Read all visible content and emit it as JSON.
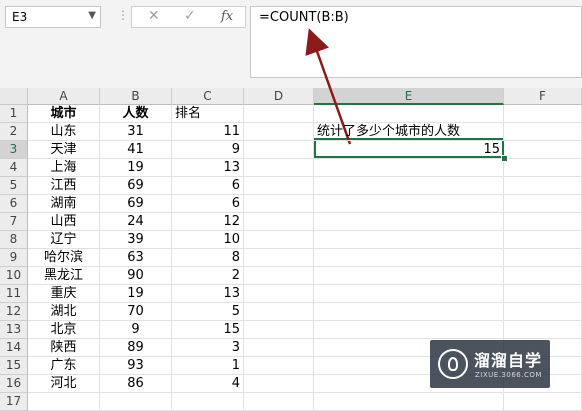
{
  "name_box": {
    "value": "E3",
    "dropdown_icon": "chevron-down-icon"
  },
  "formula_buttons": {
    "cancel": "✕",
    "enter": "✓",
    "function": "fx"
  },
  "formula_bar": {
    "value": "=COUNT(B:B)"
  },
  "columns": [
    "A",
    "B",
    "C",
    "D",
    "E",
    "F"
  ],
  "rows": [
    "1",
    "2",
    "3",
    "4",
    "5",
    "6",
    "7",
    "8",
    "9",
    "10",
    "11",
    "12",
    "13",
    "14",
    "15",
    "16",
    "17"
  ],
  "headers": {
    "city": "城市",
    "population": "人数",
    "rank": "排名"
  },
  "table": [
    {
      "city": "山东",
      "population": "31",
      "rank": "11"
    },
    {
      "city": "天津",
      "population": "41",
      "rank": "9"
    },
    {
      "city": "上海",
      "population": "19",
      "rank": "13"
    },
    {
      "city": "江西",
      "population": "69",
      "rank": "6"
    },
    {
      "city": "湖南",
      "population": "69",
      "rank": "6"
    },
    {
      "city": "山西",
      "population": "24",
      "rank": "12"
    },
    {
      "city": "辽宁",
      "population": "39",
      "rank": "10"
    },
    {
      "city": "哈尔滨",
      "population": "63",
      "rank": "8"
    },
    {
      "city": "黑龙江",
      "population": "90",
      "rank": "2"
    },
    {
      "city": "重庆",
      "population": "19",
      "rank": "13"
    },
    {
      "city": "湖北",
      "population": "70",
      "rank": "5"
    },
    {
      "city": "北京",
      "population": "9",
      "rank": "15"
    },
    {
      "city": "陕西",
      "population": "89",
      "rank": "3"
    },
    {
      "city": "广东",
      "population": "93",
      "rank": "1"
    },
    {
      "city": "河北",
      "population": "86",
      "rank": "4"
    }
  ],
  "e_column": {
    "label_text": "统计了多少个城市的人数",
    "result": "15"
  },
  "selected": {
    "column": "E",
    "row": "3"
  },
  "colors": {
    "accent_green": "#217346",
    "annotation_arrow": "#8b1a1a"
  },
  "watermark": {
    "title": "溜溜自学",
    "url": "ZIXUE.3066.COM"
  }
}
